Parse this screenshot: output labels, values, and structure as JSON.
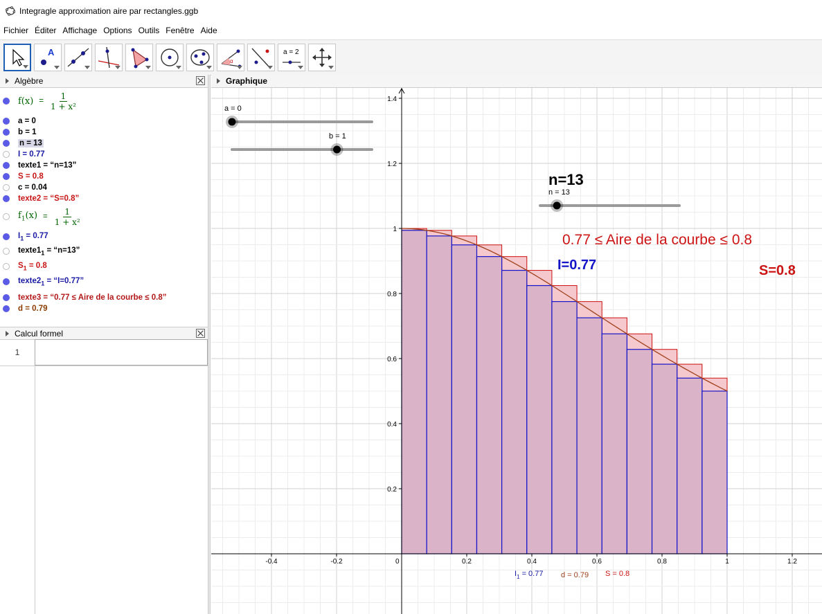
{
  "window": {
    "title": "Integragle approximation aire par rectangles.ggb"
  },
  "menu": [
    "Fichier",
    "Éditer",
    "Affichage",
    "Options",
    "Outils",
    "Fenêtre",
    "Aide"
  ],
  "toolbar": {
    "tools": [
      "move-tool",
      "point-tool",
      "line-tool",
      "perpendicular-tool",
      "polygon-tool",
      "circle-tool",
      "conic-tool",
      "angle-tool",
      "reflect-tool",
      "slider-tool",
      "move-graphics-tool"
    ],
    "slider_tool_label": "a = 2"
  },
  "algebra": {
    "header": "Algèbre",
    "f_name": "f(x)",
    "f_num": "1",
    "f_den": "1 + x²",
    "a": "a = 0",
    "b": "b = 1",
    "n": "n = 13",
    "I": "I = 0.77",
    "texte1": "texte1 = “n=13”",
    "S": "S = 0.8",
    "c": "c = 0.04",
    "texte2": "texte2 = “S=0.8”",
    "f1_name": "f",
    "f1_sub": "1",
    "f1_arg": "(x)",
    "f1_num": "1",
    "f1_den": "1 + x²",
    "I1_a": "I",
    "I1_sub": "1",
    "I1_b": " = 0.77",
    "texte1_1_a": "texte1",
    "texte1_1_sub": "1",
    "texte1_1_b": " = “n=13”",
    "S1_a": "S",
    "S1_sub": "1",
    "S1_b": " = 0.8",
    "texte2_1_a": "texte2",
    "texte2_1_sub": "1",
    "texte2_1_b": " = “I=0.77”",
    "texte3": "texte3 = “0.77 ≤ Aire de la courbe ≤ 0.8”",
    "d": "d = 0.79"
  },
  "cas": {
    "header": "Calcul formel",
    "row_number": "1"
  },
  "graphics": {
    "header": "Graphique",
    "slider_a_label": "a = 0",
    "slider_b_label": "b = 1",
    "slider_n_label": "n = 13",
    "text_n": "n=13",
    "text_area": "0.77 ≤ Aire de la courbe ≤ 0.8",
    "text_I": "I=0.77",
    "text_S": "S=0.8",
    "label_I1_a": "I",
    "label_I1_sub": "1",
    "label_I1_b": " = 0.77",
    "label_d": "d = 0.79",
    "label_S": "S = 0.8",
    "x_ticks": [
      "-0.4",
      "-0.2",
      "0",
      "0.2",
      "0.4",
      "0.6",
      "0.8",
      "1",
      "1.2"
    ],
    "y_ticks": [
      "0.2",
      "0.4",
      "0.6",
      "0.8",
      "1",
      "1.2",
      "1.4"
    ],
    "colors": {
      "upper": "#cc1010",
      "lower": "#1414c8",
      "fill": "#d8b0c8",
      "curve": "#a0401c"
    }
  },
  "chart_data": {
    "type": "area",
    "function": "f(x) = 1/(1+x²)",
    "a": 0,
    "b": 1,
    "n": 13,
    "xlim": [
      -0.55,
      1.3
    ],
    "ylim": [
      -0.18,
      1.42
    ],
    "lower_sum": 0.77,
    "upper_sum": 0.8,
    "grid": true
  }
}
